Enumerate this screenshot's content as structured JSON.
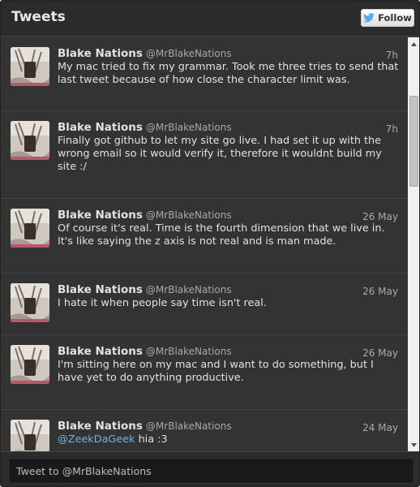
{
  "header": {
    "title": "Tweets",
    "follow_label": "Follow",
    "follow_icon": "twitter-bird-icon"
  },
  "colors": {
    "background": "#333333",
    "text": "#e2e2e2",
    "link": "#6fb3e8"
  },
  "tweets": [
    {
      "name": "Blake Nations",
      "handle": "@MrBlakeNations",
      "time": "7h",
      "text": "My mac tried to fix my grammar. Took me three tries to send that last tweet because of how close the character limit was."
    },
    {
      "name": "Blake Nations",
      "handle": "@MrBlakeNations",
      "time": "7h",
      "text": "Finally got github to let my site go live. I had set it up with the wrong email so it would verify it, therefore it wouldnt build my site :/"
    },
    {
      "name": "Blake Nations",
      "handle": "@MrBlakeNations",
      "time": "26 May",
      "text": "Of course it's real. Time is the fourth dimension that we live in. It's like saying the z axis is not real and is man made."
    },
    {
      "name": "Blake Nations",
      "handle": "@MrBlakeNations",
      "time": "26 May",
      "text": "I hate it when people say time isn't real."
    },
    {
      "name": "Blake Nations",
      "handle": "@MrBlakeNations",
      "time": "26 May",
      "text": "I'm sitting here on my mac and I want to do something, but I have yet to do anything productive."
    },
    {
      "name": "Blake Nations",
      "handle": "@MrBlakeNations",
      "time": "24 May",
      "mention": "@ZeekDaGeek",
      "text": " hia :3"
    }
  ],
  "composer": {
    "placeholder": "Tweet to @MrBlakeNations"
  }
}
